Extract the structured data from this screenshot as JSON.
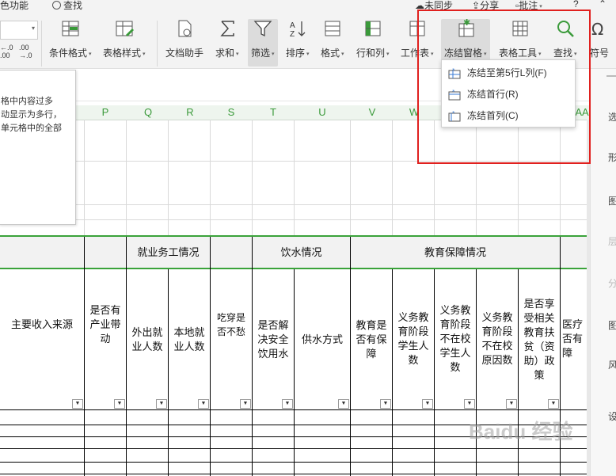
{
  "topbar": {
    "left_text": "色功能",
    "search": "查找",
    "sync": "未同步",
    "share": "分享",
    "comment": "批注",
    "help": "?"
  },
  "number_format": {
    "dec_increase": "←.0 .00",
    "dec_decrease": ".00 →.0"
  },
  "ribbon": {
    "cond_format": "条件格式",
    "table_style": "表格样式",
    "doc_assistant": "文档助手",
    "sum": "求和",
    "filter": "筛选",
    "sort": "排序",
    "format": "格式",
    "rowcol": "行和列",
    "worksheet": "工作表",
    "freeze": "冻结窗格",
    "table_tools": "表格工具",
    "find": "查找",
    "symbol": "符号"
  },
  "freeze_menu": [
    {
      "label": "冻结至第5行L列(F)",
      "icon": "freeze-rowcol-icon"
    },
    {
      "label": "冻结首行(R)",
      "icon": "freeze-first-row-icon"
    },
    {
      "label": "冻结首列(C)",
      "icon": "freeze-first-col-icon"
    }
  ],
  "tooltip": {
    "lines": [
      "格中内容过多",
      "动显示为多行，",
      "单元格中的全部"
    ]
  },
  "columns": [
    "P",
    "Q",
    "R",
    "S",
    "T",
    "U",
    "V",
    "W",
    "AA"
  ],
  "sheet": {
    "groups": {
      "employment": "就业务工情况",
      "water": "饮水情况",
      "education": "教育保障情况"
    },
    "headers": {
      "income": "主要收入来源",
      "industry": "是否有产业带动",
      "outside_workers": "外出就业人数",
      "local_workers": "本地就业人数",
      "food_clothing": "吃穿是否不愁",
      "safe_water": "是否解决安全饮用水",
      "water_supply": "供水方式",
      "edu_guaranteed": "教育是否有保障",
      "compulsory_students": "义务教育阶段学生人数",
      "out_of_school": "义务教育阶段不在校学生人数",
      "out_of_school_reason": "义务教育阶段不在校原因数",
      "poverty_policy": "是否享受相关教育扶贫（资助）政策",
      "medical": "医疗否有障"
    }
  },
  "right_panel": [
    "选",
    "形",
    "图",
    "层",
    "分",
    "图",
    "风",
    "设"
  ],
  "watermark": "Baidu 经验"
}
